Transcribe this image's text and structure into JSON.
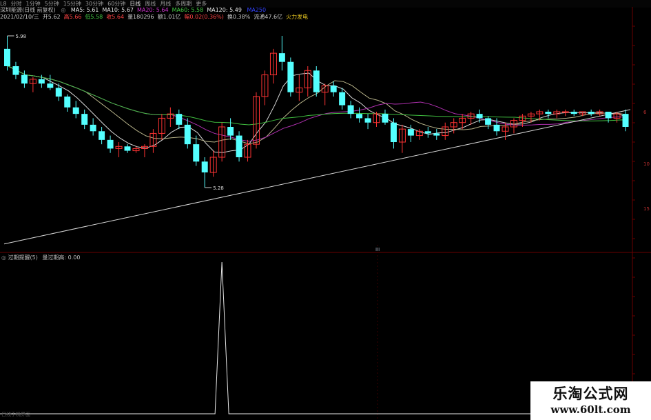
{
  "toolbar": {
    "items": [
      "L8",
      "分时",
      "1分钟",
      "5分钟",
      "15分钟",
      "30分钟",
      "60分钟",
      "日线",
      "周线",
      "月线",
      "多周期",
      "更多"
    ],
    "active_index": 7
  },
  "main_legend": {
    "title": "深圳能源(日线 前复权)",
    "ma": [
      {
        "label": "MA5: 5.61",
        "color": "#e8e8e8"
      },
      {
        "label": "MA10: 5.67",
        "color": "#e8e8e8"
      },
      {
        "label": "MA20: 5.64",
        "color": "#cc33cc"
      },
      {
        "label": "MA60: 5.58",
        "color": "#44cc44"
      },
      {
        "label": "MA120: 5.49",
        "color": "#e8e8e8"
      }
    ],
    "ma_extra": "MA250"
  },
  "info_bar": {
    "items": [
      {
        "text": "2021/02/10/三",
        "color": "#c8c8c8"
      },
      {
        "text": "开5.62",
        "color": "#c8c8c8"
      },
      {
        "text": "高5.66",
        "color": "#ff4444"
      },
      {
        "text": "低5.58",
        "color": "#44cc44"
      },
      {
        "text": "收5.64",
        "color": "#ff4444"
      },
      {
        "text": "量180296",
        "color": "#c8c8c8"
      },
      {
        "text": "额1.01亿",
        "color": "#c8c8c8"
      },
      {
        "text": "幅0.02(0.36%)",
        "color": "#ff4444"
      },
      {
        "text": "换0.38%",
        "color": "#c8c8c8"
      },
      {
        "text": "流通47.6亿",
        "color": "#c8c8c8"
      },
      {
        "text": "火力发电",
        "color": "#e0c020"
      }
    ]
  },
  "annotations": {
    "high": "5.98",
    "low": "5.28",
    "marker": "III"
  },
  "right_axis": [
    "6",
    "10",
    "15"
  ],
  "sub_legend": {
    "title": "过期提醒(5)",
    "value": "量过期高: 0.00"
  },
  "footer": "日线手机界面",
  "watermark": {
    "title": "乐淘公式网",
    "url": "www.60lt.com"
  },
  "colors": {
    "up": "#ff3333",
    "down": "#54ffff",
    "ma_white": "#d8d8d8",
    "ma_yellow": "#b8b48a",
    "ma_purple": "#b030b0",
    "ma_green": "#40c040",
    "grid": "#6a0000"
  },
  "chart_data": {
    "type": "candlestick",
    "candles": [
      [
        5.92,
        5.98,
        5.82,
        5.84
      ],
      [
        5.84,
        5.86,
        5.78,
        5.8
      ],
      [
        5.8,
        5.82,
        5.74,
        5.76
      ],
      [
        5.76,
        5.79,
        5.72,
        5.78
      ],
      [
        5.78,
        5.8,
        5.74,
        5.76
      ],
      [
        5.76,
        5.8,
        5.73,
        5.74
      ],
      [
        5.74,
        5.76,
        5.68,
        5.7
      ],
      [
        5.7,
        5.71,
        5.63,
        5.65
      ],
      [
        5.65,
        5.68,
        5.6,
        5.62
      ],
      [
        5.62,
        5.64,
        5.55,
        5.57
      ],
      [
        5.57,
        5.6,
        5.52,
        5.54
      ],
      [
        5.54,
        5.56,
        5.48,
        5.5
      ],
      [
        5.5,
        5.52,
        5.44,
        5.46
      ],
      [
        5.46,
        5.49,
        5.42,
        5.47
      ],
      [
        5.47,
        5.48,
        5.44,
        5.45
      ],
      [
        5.45,
        5.47,
        5.44,
        5.46
      ],
      [
        5.46,
        5.48,
        5.42,
        5.47
      ],
      [
        5.47,
        5.55,
        5.44,
        5.53
      ],
      [
        5.53,
        5.62,
        5.5,
        5.6
      ],
      [
        5.6,
        5.65,
        5.56,
        5.62
      ],
      [
        5.62,
        5.64,
        5.55,
        5.57
      ],
      [
        5.57,
        5.6,
        5.46,
        5.48
      ],
      [
        5.48,
        5.52,
        5.38,
        5.4
      ],
      [
        5.4,
        5.42,
        5.28,
        5.35
      ],
      [
        5.35,
        5.45,
        5.33,
        5.42
      ],
      [
        5.42,
        5.58,
        5.4,
        5.56
      ],
      [
        5.56,
        5.6,
        5.5,
        5.52
      ],
      [
        5.52,
        5.54,
        5.4,
        5.42
      ],
      [
        5.42,
        5.5,
        5.4,
        5.48
      ],
      [
        5.48,
        5.72,
        5.46,
        5.7
      ],
      [
        5.7,
        5.82,
        5.66,
        5.8
      ],
      [
        5.8,
        5.92,
        5.76,
        5.9
      ],
      [
        5.9,
        5.98,
        5.82,
        5.86
      ],
      [
        5.86,
        5.88,
        5.7,
        5.72
      ],
      [
        5.72,
        5.8,
        5.68,
        5.74
      ],
      [
        5.74,
        5.84,
        5.7,
        5.82
      ],
      [
        5.82,
        5.84,
        5.7,
        5.72
      ],
      [
        5.72,
        5.76,
        5.66,
        5.75
      ],
      [
        5.75,
        5.77,
        5.7,
        5.72
      ],
      [
        5.72,
        5.74,
        5.64,
        5.66
      ],
      [
        5.66,
        5.68,
        5.6,
        5.62
      ],
      [
        5.62,
        5.65,
        5.58,
        5.6
      ],
      [
        5.6,
        5.62,
        5.55,
        5.58
      ],
      [
        5.58,
        5.63,
        5.56,
        5.62
      ],
      [
        5.62,
        5.64,
        5.57,
        5.58
      ],
      [
        5.58,
        5.6,
        5.46,
        5.49
      ],
      [
        5.49,
        5.57,
        5.44,
        5.55
      ],
      [
        5.55,
        5.57,
        5.49,
        5.52
      ],
      [
        5.52,
        5.55,
        5.5,
        5.54
      ],
      [
        5.54,
        5.56,
        5.51,
        5.53
      ],
      [
        5.53,
        5.55,
        5.5,
        5.52
      ],
      [
        5.52,
        5.58,
        5.5,
        5.56
      ],
      [
        5.56,
        5.6,
        5.53,
        5.58
      ],
      [
        5.58,
        5.62,
        5.55,
        5.6
      ],
      [
        5.6,
        5.63,
        5.57,
        5.62
      ],
      [
        5.62,
        5.64,
        5.58,
        5.6
      ],
      [
        5.6,
        5.61,
        5.55,
        5.57
      ],
      [
        5.57,
        5.6,
        5.52,
        5.54
      ],
      [
        5.54,
        5.58,
        5.5,
        5.56
      ],
      [
        5.56,
        5.6,
        5.53,
        5.59
      ],
      [
        5.59,
        5.62,
        5.56,
        5.61
      ],
      [
        5.61,
        5.63,
        5.58,
        5.62
      ],
      [
        5.62,
        5.64,
        5.59,
        5.63
      ],
      [
        5.63,
        5.64,
        5.6,
        5.62
      ],
      [
        5.62,
        5.64,
        5.6,
        5.63
      ],
      [
        5.63,
        5.64,
        5.61,
        5.63
      ],
      [
        5.63,
        5.64,
        5.61,
        5.62
      ],
      [
        5.62,
        5.63,
        5.61,
        5.63
      ],
      [
        5.63,
        5.64,
        5.61,
        5.62
      ],
      [
        5.62,
        5.64,
        5.61,
        5.63
      ],
      [
        5.63,
        5.63,
        5.58,
        5.6
      ],
      [
        5.6,
        5.63,
        5.58,
        5.62
      ],
      [
        5.62,
        5.64,
        5.54,
        5.56
      ]
    ],
    "ylim": [
      5.0,
      6.05
    ],
    "indicator": {
      "spike_index": 25,
      "spike_value": 1,
      "baseline": 0
    }
  }
}
